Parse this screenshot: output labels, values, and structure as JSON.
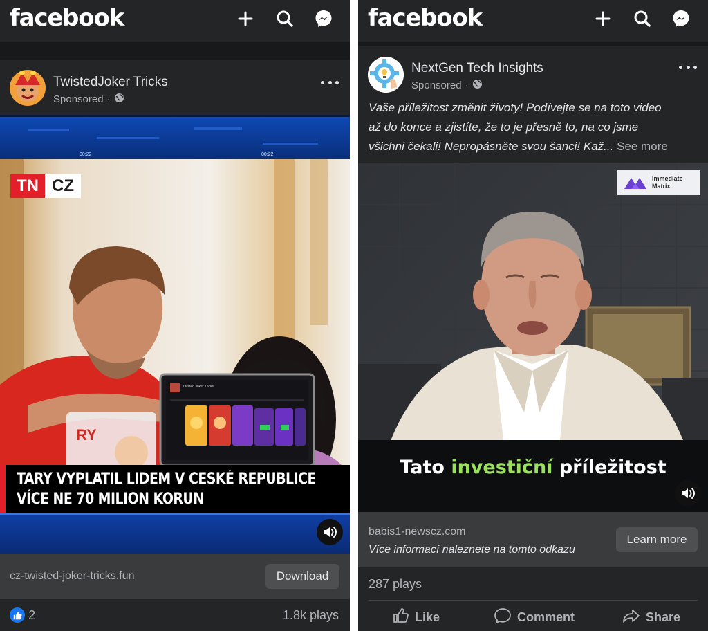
{
  "left": {
    "app": {
      "logo": "facebook"
    },
    "post": {
      "page_name": "TwistedJoker Tricks",
      "sponsored_label": "Sponsored",
      "video": {
        "tn_logo_left": "TN",
        "tn_logo_right": "CZ",
        "laptop_title": "Twisted Joker Tricks",
        "headline_line1": "TARY VYPLATIL LIDEM V CESKÉ REPUBLICE",
        "headline_line2": "VÍCE NE 70 MILION KORUN",
        "timecode_left": "00:22",
        "timecode_right": "00:22"
      },
      "cta": {
        "url": "cz-twisted-joker-tricks.fun",
        "button_label": "Download"
      },
      "reactions": {
        "like_count": "2",
        "plays": "1.8k plays"
      }
    }
  },
  "right": {
    "app": {
      "logo": "facebook"
    },
    "post": {
      "page_name": "NextGen Tech Insights",
      "sponsored_label": "Sponsored",
      "caption_line1": "Vaše příležitost změnit životy! Podívejte se na toto video",
      "caption_line2": "až do konce a zjistíte, že to je přesně to, na co jsme",
      "caption_line3": "všichni čekali! Nepropásněte svou šanci! Kaž...",
      "see_more": "See more",
      "video": {
        "badge_line1": "Immediate",
        "badge_line2": "Matrix",
        "subtitle_prefix": "Tato ",
        "subtitle_highlight": "investiční",
        "subtitle_suffix": " příležitost"
      },
      "cta": {
        "url": "babis1-newscz.com",
        "description": "Více informací naleznete na tomto odkazu",
        "button_label": "Learn more"
      },
      "plays": "287 plays",
      "actions": {
        "like": "Like",
        "comment": "Comment",
        "share": "Share"
      }
    }
  },
  "colors": {
    "app_background": "#242526",
    "divider": "#18191a",
    "cta_background": "#3a3b3c",
    "button_background": "#4e4f50",
    "like_blue": "#1877f2",
    "subtitle_green": "#9be15d",
    "tn_red": "#e3202a"
  },
  "icons": [
    "plus-icon",
    "search-icon",
    "messenger-icon",
    "globe-icon",
    "more-icon",
    "sound-icon",
    "like-reaction-icon",
    "thumbs-up-icon",
    "comment-icon",
    "share-icon"
  ]
}
